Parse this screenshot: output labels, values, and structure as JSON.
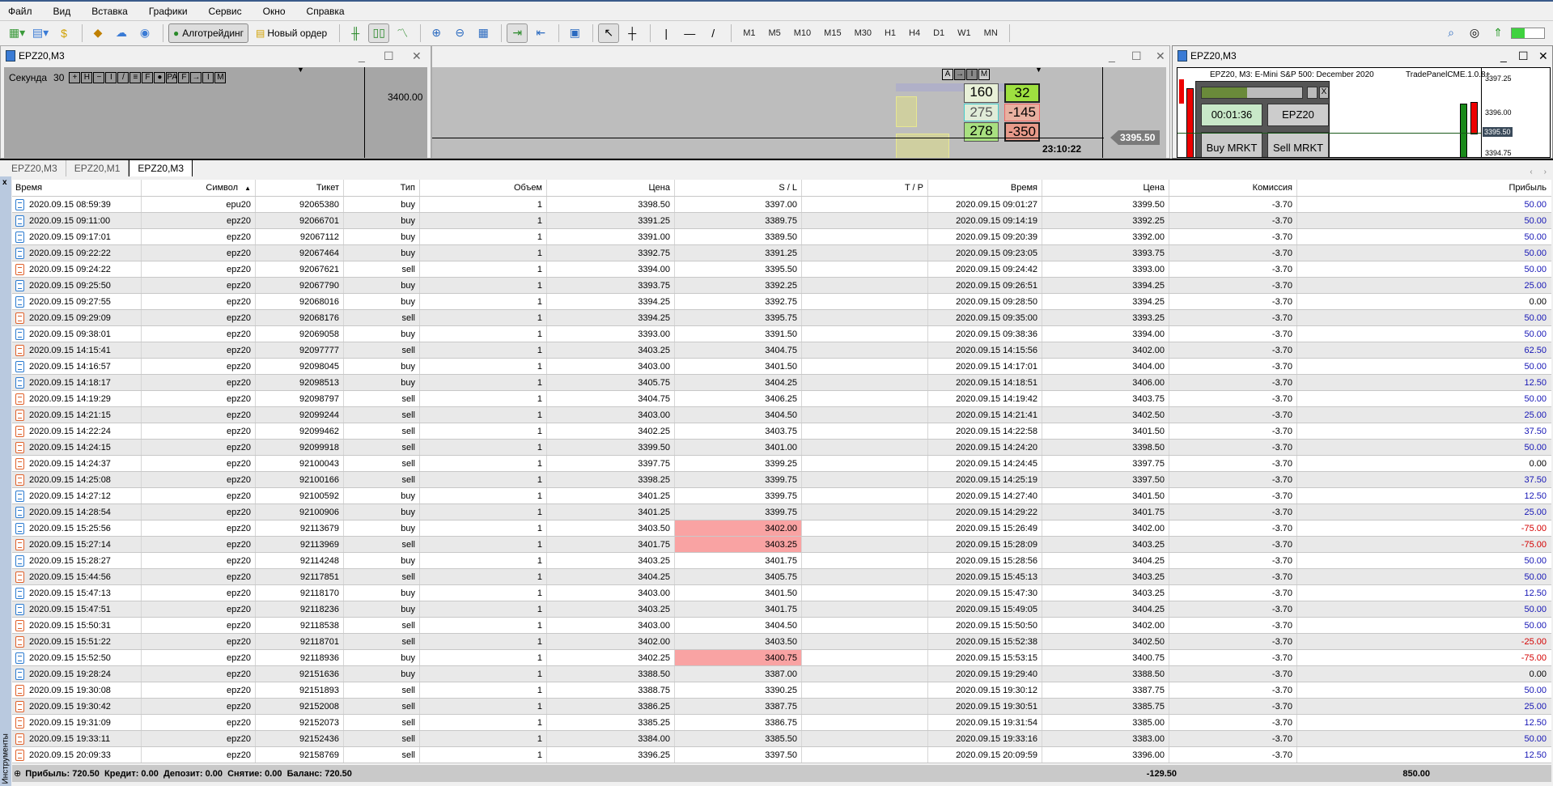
{
  "menu": [
    "Файл",
    "Вид",
    "Вставка",
    "Графики",
    "Сервис",
    "Окно",
    "Справка"
  ],
  "toolbar": {
    "algo": "Алготрейдинг",
    "new_order": "Новый ордер",
    "timeframes": [
      "M1",
      "M5",
      "M10",
      "M15",
      "M30",
      "H1",
      "H4",
      "D1",
      "W1",
      "MN"
    ]
  },
  "chart1": {
    "title": "EPZ20,M3",
    "period_label": "Секунда",
    "period_value": "30",
    "tools": [
      "+",
      "H",
      "−",
      "I",
      "/",
      "≡",
      "F",
      "●",
      "PA",
      "F",
      "→",
      "I",
      "M"
    ],
    "price": "3400.00"
  },
  "chart2": {
    "tools": [
      "A",
      "→",
      "I",
      "M"
    ],
    "bid": [
      "160",
      "275",
      "278"
    ],
    "delta": [
      "32",
      "-145",
      "-350"
    ],
    "time": "23:10:22",
    "price": "3395.50"
  },
  "chart3": {
    "title": "EPZ20,M3",
    "header": "EPZ20, M3:  E-Mini S&P 500: December 2020",
    "indicator": "TradePanelCME.1.0.8+",
    "timer": "00:01:36",
    "symbol": "EPZ20",
    "buy": "Buy MRKT",
    "sell": "Sell MRKT",
    "close": "X",
    "prices": [
      "3397.25",
      "3396.00",
      "3395.50",
      "3394.75"
    ]
  },
  "tabs": [
    "EPZ20,M3",
    "EPZ20,M1",
    "EPZ20,M3"
  ],
  "side_label": "Инструменты",
  "columns": [
    "Время",
    "Символ",
    "Тикет",
    "Тип",
    "Объем",
    "Цена",
    "S / L",
    "T / P",
    "Время",
    "Цена",
    "Комиссия",
    "Прибыль"
  ],
  "sort_indicator": "▲",
  "rows": [
    [
      "2020.09.15 08:59:39",
      "epu20",
      "92065380",
      "buy",
      "1",
      "3398.50",
      "3397.00",
      "",
      "2020.09.15 09:01:27",
      "3399.50",
      "-3.70",
      "50.00"
    ],
    [
      "2020.09.15 09:11:00",
      "epz20",
      "92066701",
      "buy",
      "1",
      "3391.25",
      "3389.75",
      "",
      "2020.09.15 09:14:19",
      "3392.25",
      "-3.70",
      "50.00"
    ],
    [
      "2020.09.15 09:17:01",
      "epz20",
      "92067112",
      "buy",
      "1",
      "3391.00",
      "3389.50",
      "",
      "2020.09.15 09:20:39",
      "3392.00",
      "-3.70",
      "50.00"
    ],
    [
      "2020.09.15 09:22:22",
      "epz20",
      "92067464",
      "buy",
      "1",
      "3392.75",
      "3391.25",
      "",
      "2020.09.15 09:23:05",
      "3393.75",
      "-3.70",
      "50.00"
    ],
    [
      "2020.09.15 09:24:22",
      "epz20",
      "92067621",
      "sell",
      "1",
      "3394.00",
      "3395.50",
      "",
      "2020.09.15 09:24:42",
      "3393.00",
      "-3.70",
      "50.00"
    ],
    [
      "2020.09.15 09:25:50",
      "epz20",
      "92067790",
      "buy",
      "1",
      "3393.75",
      "3392.25",
      "",
      "2020.09.15 09:26:51",
      "3394.25",
      "-3.70",
      "25.00"
    ],
    [
      "2020.09.15 09:27:55",
      "epz20",
      "92068016",
      "buy",
      "1",
      "3394.25",
      "3392.75",
      "",
      "2020.09.15 09:28:50",
      "3394.25",
      "-3.70",
      "0.00"
    ],
    [
      "2020.09.15 09:29:09",
      "epz20",
      "92068176",
      "sell",
      "1",
      "3394.25",
      "3395.75",
      "",
      "2020.09.15 09:35:00",
      "3393.25",
      "-3.70",
      "50.00"
    ],
    [
      "2020.09.15 09:38:01",
      "epz20",
      "92069058",
      "buy",
      "1",
      "3393.00",
      "3391.50",
      "",
      "2020.09.15 09:38:36",
      "3394.00",
      "-3.70",
      "50.00"
    ],
    [
      "2020.09.15 14:15:41",
      "epz20",
      "92097777",
      "sell",
      "1",
      "3403.25",
      "3404.75",
      "",
      "2020.09.15 14:15:56",
      "3402.00",
      "-3.70",
      "62.50"
    ],
    [
      "2020.09.15 14:16:57",
      "epz20",
      "92098045",
      "buy",
      "1",
      "3403.00",
      "3401.50",
      "",
      "2020.09.15 14:17:01",
      "3404.00",
      "-3.70",
      "50.00"
    ],
    [
      "2020.09.15 14:18:17",
      "epz20",
      "92098513",
      "buy",
      "1",
      "3405.75",
      "3404.25",
      "",
      "2020.09.15 14:18:51",
      "3406.00",
      "-3.70",
      "12.50"
    ],
    [
      "2020.09.15 14:19:29",
      "epz20",
      "92098797",
      "sell",
      "1",
      "3404.75",
      "3406.25",
      "",
      "2020.09.15 14:19:42",
      "3403.75",
      "-3.70",
      "50.00"
    ],
    [
      "2020.09.15 14:21:15",
      "epz20",
      "92099244",
      "sell",
      "1",
      "3403.00",
      "3404.50",
      "",
      "2020.09.15 14:21:41",
      "3402.50",
      "-3.70",
      "25.00"
    ],
    [
      "2020.09.15 14:22:24",
      "epz20",
      "92099462",
      "sell",
      "1",
      "3402.25",
      "3403.75",
      "",
      "2020.09.15 14:22:58",
      "3401.50",
      "-3.70",
      "37.50"
    ],
    [
      "2020.09.15 14:24:15",
      "epz20",
      "92099918",
      "sell",
      "1",
      "3399.50",
      "3401.00",
      "",
      "2020.09.15 14:24:20",
      "3398.50",
      "-3.70",
      "50.00"
    ],
    [
      "2020.09.15 14:24:37",
      "epz20",
      "92100043",
      "sell",
      "1",
      "3397.75",
      "3399.25",
      "",
      "2020.09.15 14:24:45",
      "3397.75",
      "-3.70",
      "0.00"
    ],
    [
      "2020.09.15 14:25:08",
      "epz20",
      "92100166",
      "sell",
      "1",
      "3398.25",
      "3399.75",
      "",
      "2020.09.15 14:25:19",
      "3397.50",
      "-3.70",
      "37.50"
    ],
    [
      "2020.09.15 14:27:12",
      "epz20",
      "92100592",
      "buy",
      "1",
      "3401.25",
      "3399.75",
      "",
      "2020.09.15 14:27:40",
      "3401.50",
      "-3.70",
      "12.50"
    ],
    [
      "2020.09.15 14:28:54",
      "epz20",
      "92100906",
      "buy",
      "1",
      "3401.25",
      "3399.75",
      "",
      "2020.09.15 14:29:22",
      "3401.75",
      "-3.70",
      "25.00"
    ],
    [
      "2020.09.15 15:25:56",
      "epz20",
      "92113679",
      "buy",
      "1",
      "3403.50",
      "3402.00",
      "",
      "2020.09.15 15:26:49",
      "3402.00",
      "-3.70",
      "-75.00"
    ],
    [
      "2020.09.15 15:27:14",
      "epz20",
      "92113969",
      "sell",
      "1",
      "3401.75",
      "3403.25",
      "",
      "2020.09.15 15:28:09",
      "3403.25",
      "-3.70",
      "-75.00"
    ],
    [
      "2020.09.15 15:28:27",
      "epz20",
      "92114248",
      "buy",
      "1",
      "3403.25",
      "3401.75",
      "",
      "2020.09.15 15:28:56",
      "3404.25",
      "-3.70",
      "50.00"
    ],
    [
      "2020.09.15 15:44:56",
      "epz20",
      "92117851",
      "sell",
      "1",
      "3404.25",
      "3405.75",
      "",
      "2020.09.15 15:45:13",
      "3403.25",
      "-3.70",
      "50.00"
    ],
    [
      "2020.09.15 15:47:13",
      "epz20",
      "92118170",
      "buy",
      "1",
      "3403.00",
      "3401.50",
      "",
      "2020.09.15 15:47:30",
      "3403.25",
      "-3.70",
      "12.50"
    ],
    [
      "2020.09.15 15:47:51",
      "epz20",
      "92118236",
      "buy",
      "1",
      "3403.25",
      "3401.75",
      "",
      "2020.09.15 15:49:05",
      "3404.25",
      "-3.70",
      "50.00"
    ],
    [
      "2020.09.15 15:50:31",
      "epz20",
      "92118538",
      "sell",
      "1",
      "3403.00",
      "3404.50",
      "",
      "2020.09.15 15:50:50",
      "3402.00",
      "-3.70",
      "50.00"
    ],
    [
      "2020.09.15 15:51:22",
      "epz20",
      "92118701",
      "sell",
      "1",
      "3402.00",
      "3403.50",
      "",
      "2020.09.15 15:52:38",
      "3402.50",
      "-3.70",
      "-25.00"
    ],
    [
      "2020.09.15 15:52:50",
      "epz20",
      "92118936",
      "buy",
      "1",
      "3402.25",
      "3400.75",
      "",
      "2020.09.15 15:53:15",
      "3400.75",
      "-3.70",
      "-75.00"
    ],
    [
      "2020.09.15 19:28:24",
      "epz20",
      "92151636",
      "buy",
      "1",
      "3388.50",
      "3387.00",
      "",
      "2020.09.15 19:29:40",
      "3388.50",
      "-3.70",
      "0.00"
    ],
    [
      "2020.09.15 19:30:08",
      "epz20",
      "92151893",
      "sell",
      "1",
      "3388.75",
      "3390.25",
      "",
      "2020.09.15 19:30:12",
      "3387.75",
      "-3.70",
      "50.00"
    ],
    [
      "2020.09.15 19:30:42",
      "epz20",
      "92152008",
      "sell",
      "1",
      "3386.25",
      "3387.75",
      "",
      "2020.09.15 19:30:51",
      "3385.75",
      "-3.70",
      "25.00"
    ],
    [
      "2020.09.15 19:31:09",
      "epz20",
      "92152073",
      "sell",
      "1",
      "3385.25",
      "3386.75",
      "",
      "2020.09.15 19:31:54",
      "3385.00",
      "-3.70",
      "12.50"
    ],
    [
      "2020.09.15 19:33:11",
      "epz20",
      "92152436",
      "sell",
      "1",
      "3384.00",
      "3385.50",
      "",
      "2020.09.15 19:33:16",
      "3383.00",
      "-3.70",
      "50.00"
    ],
    [
      "2020.09.15 20:09:33",
      "epz20",
      "92158769",
      "sell",
      "1",
      "3396.25",
      "3397.50",
      "",
      "2020.09.15 20:09:59",
      "3396.00",
      "-3.70",
      "12.50"
    ]
  ],
  "sl_hit_rows": [
    20,
    21,
    28
  ],
  "colors": {
    "profit_positive": "#1515b5",
    "profit_negative": "#d40000",
    "sl_highlight": "#f9a3a3"
  },
  "footer": {
    "summary": "Прибыль: 720.50  Кредит: 0.00  Депозит: 0.00  Снятие: 0.00  Баланс: 720.50",
    "commission_total": "-129.50",
    "profit_total": "850.00"
  }
}
